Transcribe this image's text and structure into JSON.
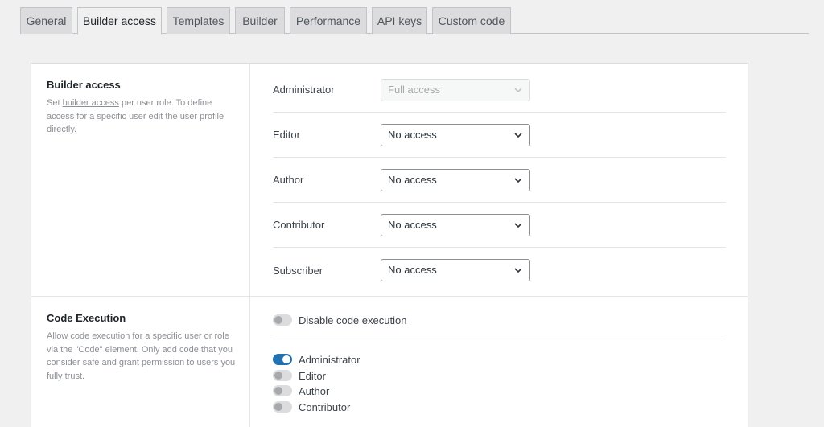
{
  "tabs": [
    {
      "label": "General"
    },
    {
      "label": "Builder access"
    },
    {
      "label": "Templates"
    },
    {
      "label": "Builder"
    },
    {
      "label": "Performance"
    },
    {
      "label": "API keys"
    },
    {
      "label": "Custom code"
    }
  ],
  "active_tab": "Builder access",
  "builder_access": {
    "title": "Builder access",
    "desc_prefix": "Set ",
    "desc_link": "builder access",
    "desc_suffix": " per user role. To define access for a specific user edit the user profile directly.",
    "roles": [
      {
        "label": "Administrator",
        "value": "Full access",
        "disabled": true
      },
      {
        "label": "Editor",
        "value": "No access",
        "disabled": false
      },
      {
        "label": "Author",
        "value": "No access",
        "disabled": false
      },
      {
        "label": "Contributor",
        "value": "No access",
        "disabled": false
      },
      {
        "label": "Subscriber",
        "value": "No access",
        "disabled": false
      }
    ]
  },
  "code_execution": {
    "title": "Code Execution",
    "description": "Allow code execution for a specific user or role via the \"Code\" element. Only add code that you consider safe and grant permission to users you fully trust.",
    "disable_label": "Disable code execution",
    "disable_checked": false,
    "roles": [
      {
        "label": "Administrator",
        "checked": true
      },
      {
        "label": "Editor",
        "checked": false
      },
      {
        "label": "Author",
        "checked": false
      },
      {
        "label": "Contributor",
        "checked": false
      }
    ]
  },
  "colors": {
    "accent": "#2271b1",
    "background": "#f0f0f1"
  }
}
